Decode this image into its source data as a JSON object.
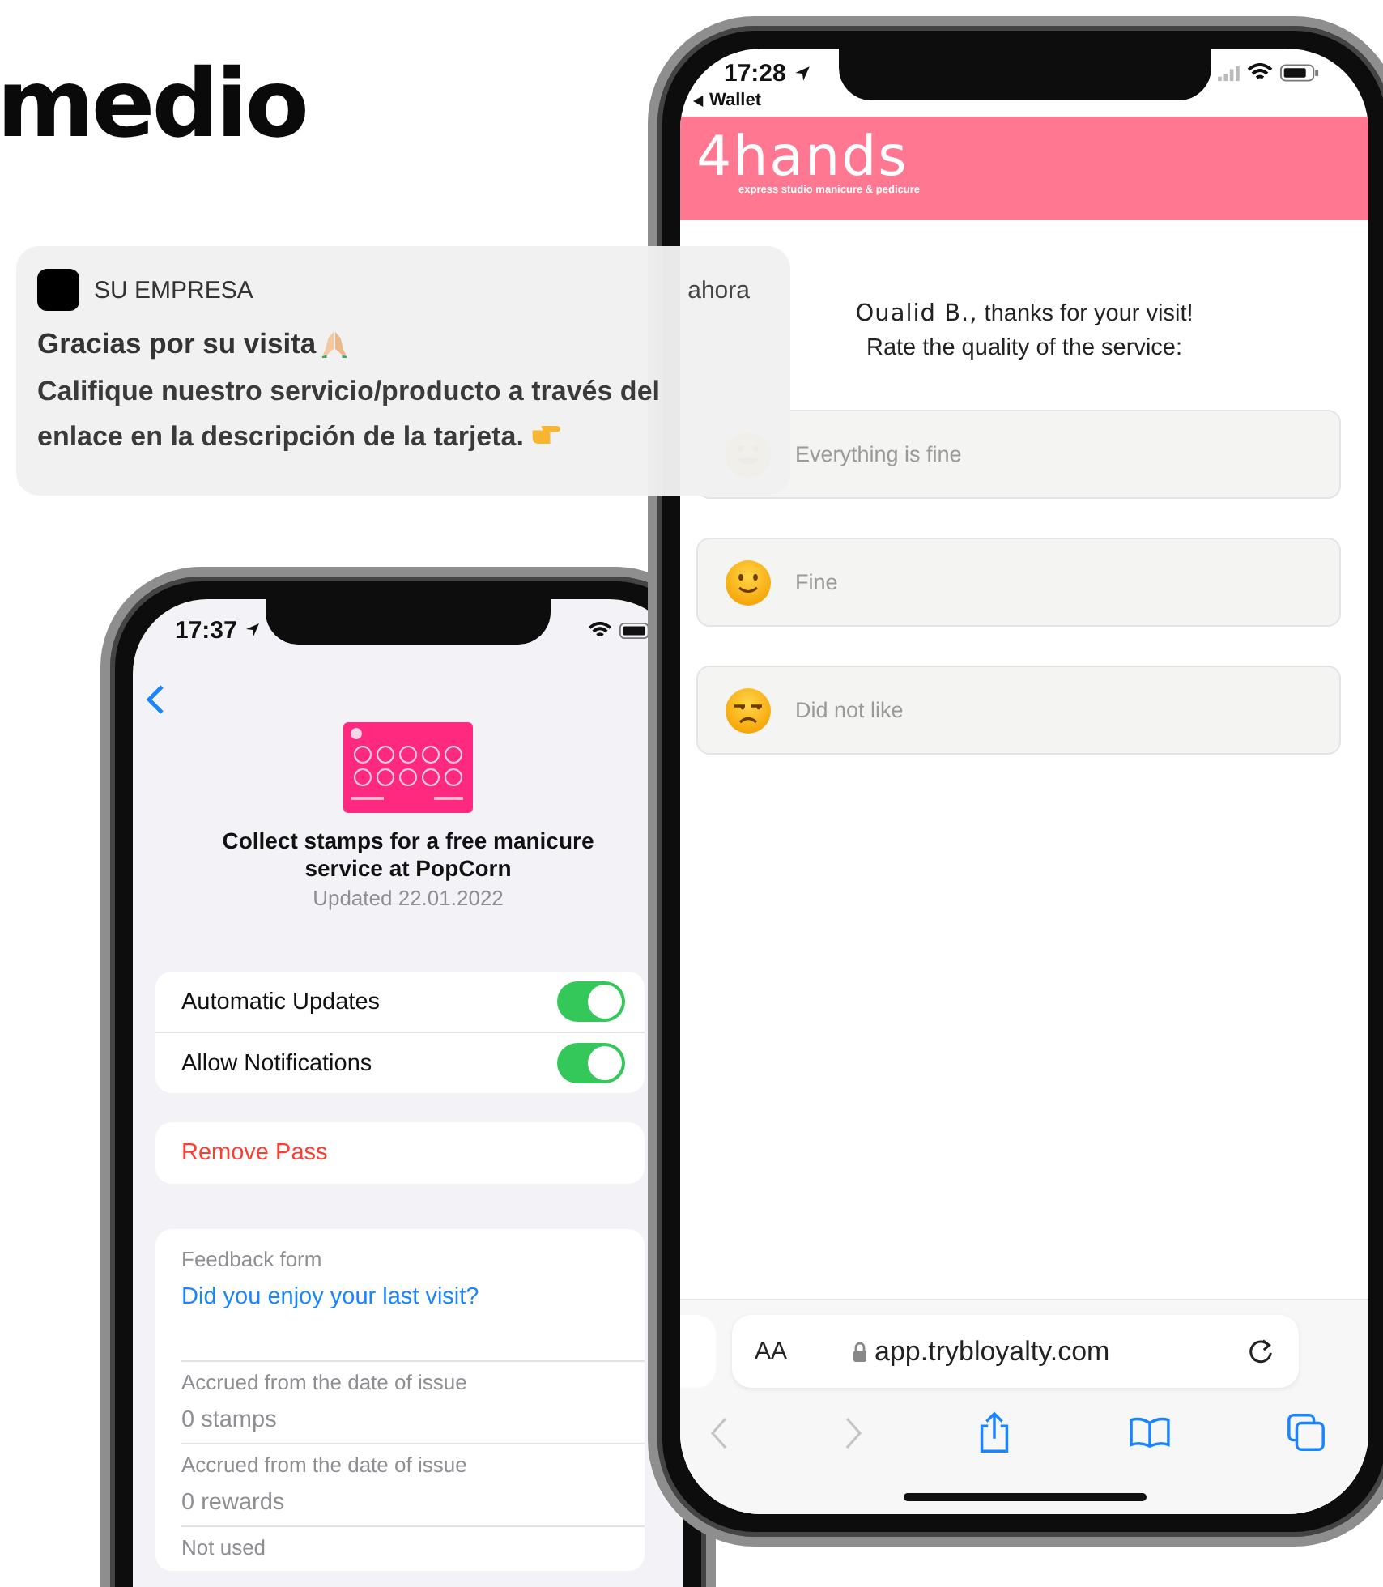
{
  "heading": "medio",
  "notification": {
    "app": "SU EMPRESA",
    "time": "ahora",
    "title": "Gracias por su visita",
    "body": "Califique nuestro servicio/producto a través del enlace en la descripción de la tarjeta."
  },
  "pass_phone": {
    "time": "17:37",
    "card_title": "Collect stamps for a free manicure service at PopCorn",
    "updated": "Updated 22.01.2022",
    "toggles": [
      {
        "label": "Automatic Updates",
        "on": true
      },
      {
        "label": "Allow Notifications",
        "on": true
      }
    ],
    "remove_button": "Remove Pass",
    "back_fields": [
      {
        "kind": "link",
        "label": "Feedback form",
        "value": "Did you enjoy your last visit?"
      },
      {
        "kind": "text",
        "label": "Accrued from the date of issue",
        "value": "0 stamps"
      },
      {
        "kind": "text",
        "label": "Accrued from the date of issue",
        "value": "0 rewards"
      },
      {
        "kind": "text",
        "label": "Not used"
      }
    ]
  },
  "browser_phone": {
    "time": "17:28",
    "back_app": "Wallet",
    "logo": "4hands",
    "tagline": "express studio manicure & pedicure",
    "greeting_name": "Oualid B.,",
    "greeting": "thanks for your visit!",
    "prompt": "Rate the quality of the service:",
    "options": [
      {
        "kind": "great",
        "label": "Everything is fine"
      },
      {
        "kind": "fine",
        "label": "Fine"
      },
      {
        "kind": "bad",
        "label": "Did not like"
      }
    ],
    "address_bar": {
      "text_size": "AA",
      "url": "app.trybloyalty.com"
    }
  }
}
